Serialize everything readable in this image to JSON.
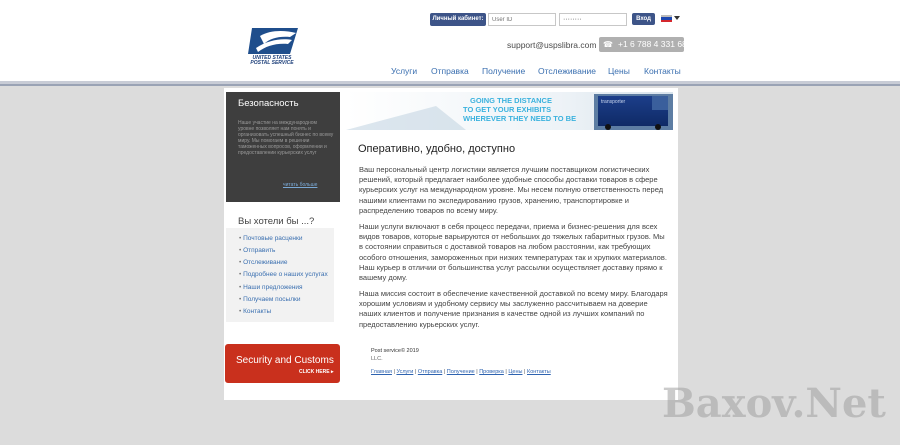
{
  "header": {
    "logo_text": "UNITED STATES POSTAL SERVICE",
    "cabinet_label": "Личный кабинет:",
    "user_placeholder": "User ID",
    "password_mask": "········",
    "login_label": "Вход",
    "email": "support@uspslibra.com",
    "phone": "+1 6 788 4 331 68",
    "nav": [
      "Услуги",
      "Отправка",
      "Получение",
      "Отслеживание",
      "Цены",
      "Контакты"
    ]
  },
  "sidebar": {
    "security_title": "Безопасность",
    "security_text": "Наше участие на международном уровне позволяет нам понять и организовать успешный бизнес по всему миру. Мы помогаем в решении таможенных вопросов, оформлении и предоставлении курьерских услуг",
    "security_more": "читать больше",
    "wish_title": "Вы хотели бы ...?",
    "links": [
      "Почтовые расценки",
      "Отправить",
      "Отслеживание",
      "Подробнее о наших услугах",
      "Наши предложения",
      "Получаем посылки",
      "Контакты"
    ],
    "banner_title": "Security and Customs",
    "banner_click": "CLICK HERE ▸"
  },
  "banner": {
    "line1": "GOING THE DISTANCE",
    "line2": "TO GET YOUR EXHIBITS",
    "line3": "WHEREVER THEY NEED TO BE",
    "truck_label": "transporter"
  },
  "main": {
    "heading": "Оперативно, удобно, доступно",
    "paragraphs": [
      "Ваш персональный центр логистики является лучшим поставщиком логистических решений, который предлагает наиболее удобные способы доставки товаров в сфере курьерских услуг на международном уровне. Мы несем полную ответственность перед нашими клиентами по экспедированию грузов, хранению, транспортировке и распределению товаров по всему миру.",
      "Наши услуги включают в себя процесс передачи, приема и бизнес-решения для всех видов товаров, которые варьируются от небольших до тяжелых габаритных грузов. Мы в состоянии справиться с доставкой товаров на любом расстоянии, как требующих особого отношения, замороженных при низких температурах так и хрупких материалов. Наш курьер в отличии от большинства услуг рассылки осуществляет доставку прямо к вашему дому.",
      "Наша миссия состоит в обеспечение качественной доставкой по всему миру. Благодаря хорошим условиям и удобному сервису мы заслуженно рассчитываем на доверие наших клиентов и получение признания в качестве одной из лучших компаний по предоставлению курьерских услуг."
    ]
  },
  "footer": {
    "copyright": "Post service© 2019",
    "llc": "LLC.",
    "links": [
      "Главная",
      "Услуги",
      "Отправка",
      "Получение",
      "Проверка",
      "Цены",
      "Контакты"
    ]
  },
  "watermark": "Baxov.Net",
  "colors": {
    "accent_blue": "#3a6fb0",
    "button_navy": "#3d5488",
    "banner_red": "#c9301d",
    "dark_panel": "#3e3e3e"
  }
}
